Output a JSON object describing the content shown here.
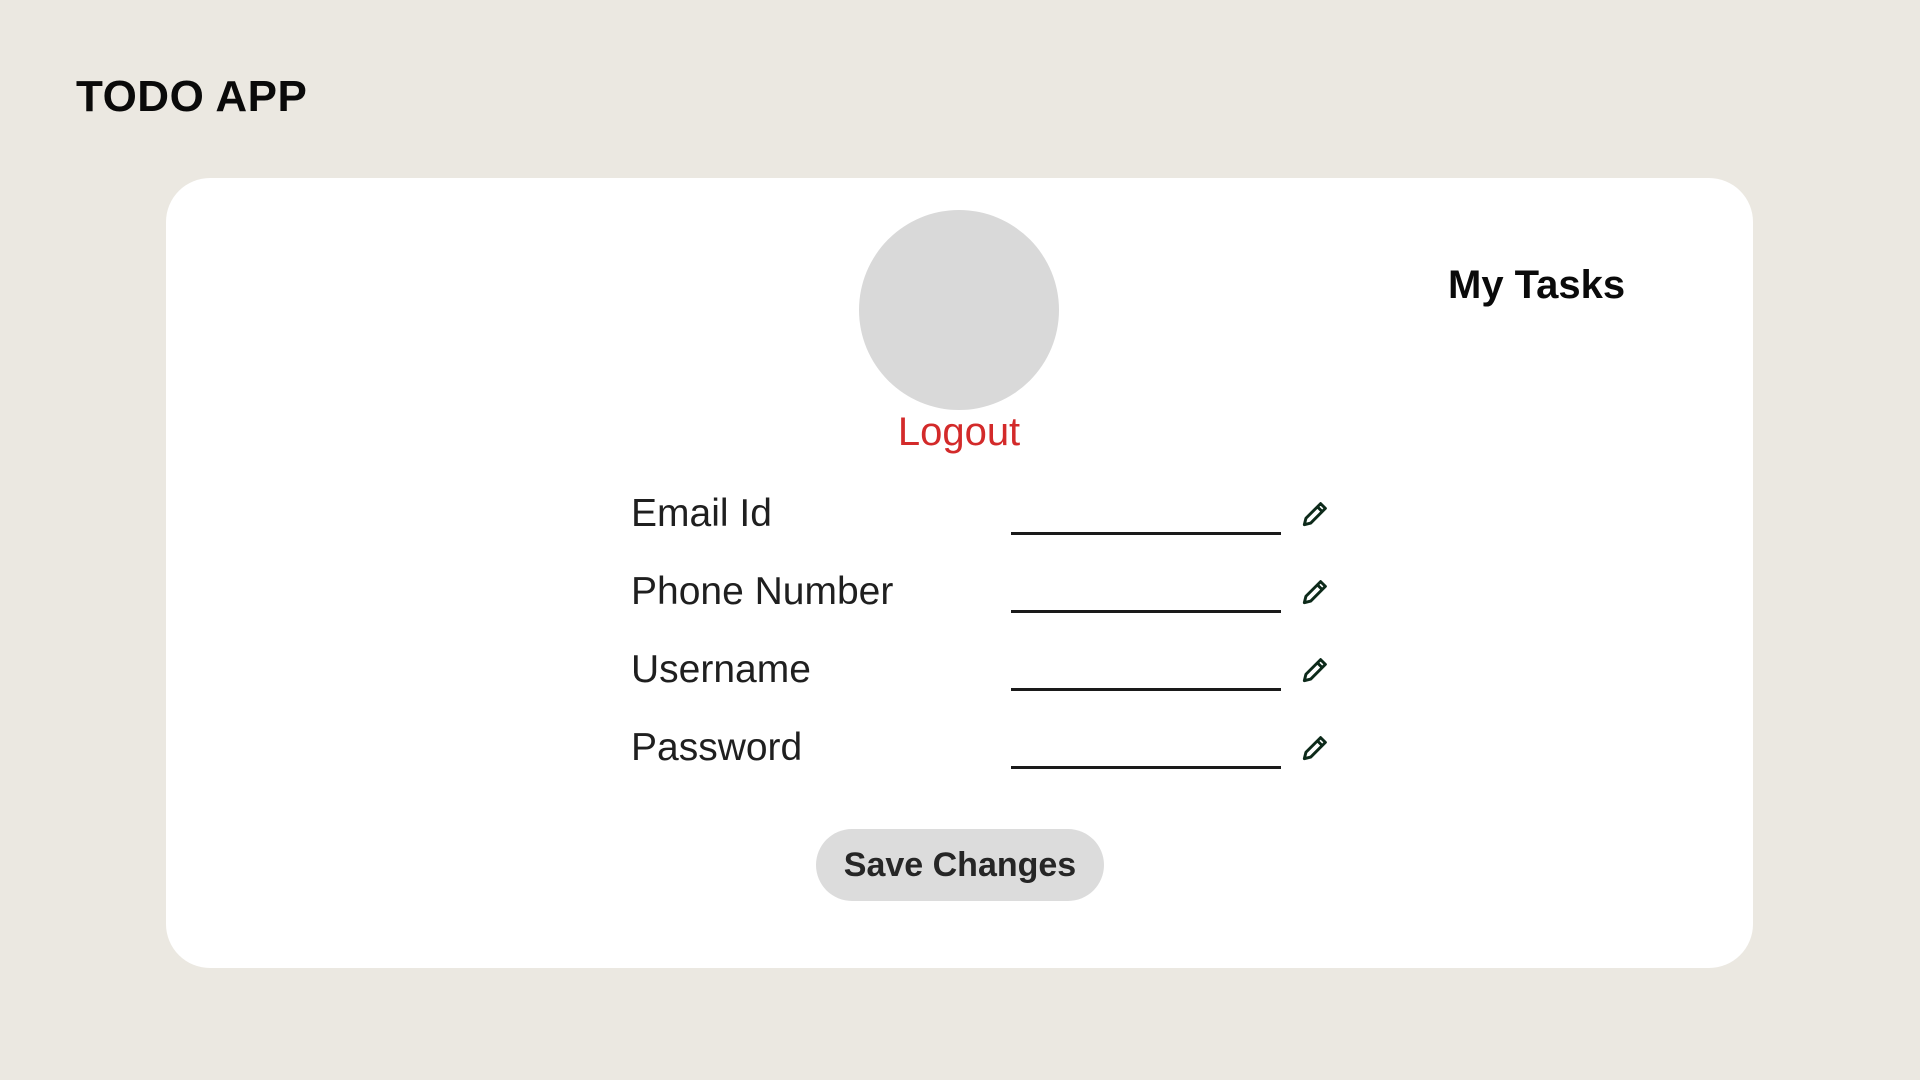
{
  "app": {
    "title": "TODO APP"
  },
  "nav": {
    "my_tasks": "My Tasks"
  },
  "profile": {
    "logout_label": "Logout"
  },
  "form": {
    "fields": [
      {
        "label": "Email Id",
        "value": "",
        "icon": "pencil-icon"
      },
      {
        "label": "Phone Number",
        "value": "",
        "icon": "pencil-icon"
      },
      {
        "label": "Username",
        "value": "",
        "icon": "pencil-icon"
      },
      {
        "label": "Password",
        "value": "",
        "icon": "pencil-icon"
      }
    ],
    "save_label": "Save Changes"
  },
  "colors": {
    "background": "#ebe8e1",
    "card": "#ffffff",
    "avatar": "#d9d9d9",
    "logout": "#d32a2a",
    "button": "#dcdcdc",
    "icon": "#0d2a1a"
  }
}
